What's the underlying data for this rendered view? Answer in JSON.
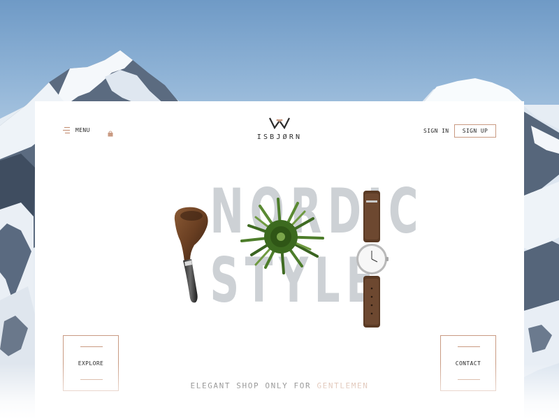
{
  "header": {
    "menu_label": "MENU",
    "menu_icon": "menu-icon",
    "cart_icon": "shopping-bag-icon",
    "logo_icon": "isbjorn-logo-icon",
    "logo_text": "ISBJØRN",
    "signin_label": "SIGN IN",
    "signup_label": "SIGN UP"
  },
  "hero": {
    "line1": "NORDIC",
    "line2": "STYLE",
    "products": [
      "pipe",
      "plant",
      "watch"
    ]
  },
  "actions": {
    "explore_label": "EXPLORE",
    "contact_label": "CONTACT"
  },
  "tagline": {
    "main": "ELEGANT SHOP ONLY FOR ",
    "accent": "GENTLEMEN"
  },
  "colors": {
    "accent": "#c99a82",
    "hero_text": "#cdd1d5",
    "text": "#2a2a2a",
    "sky": "#8fb3d6"
  }
}
